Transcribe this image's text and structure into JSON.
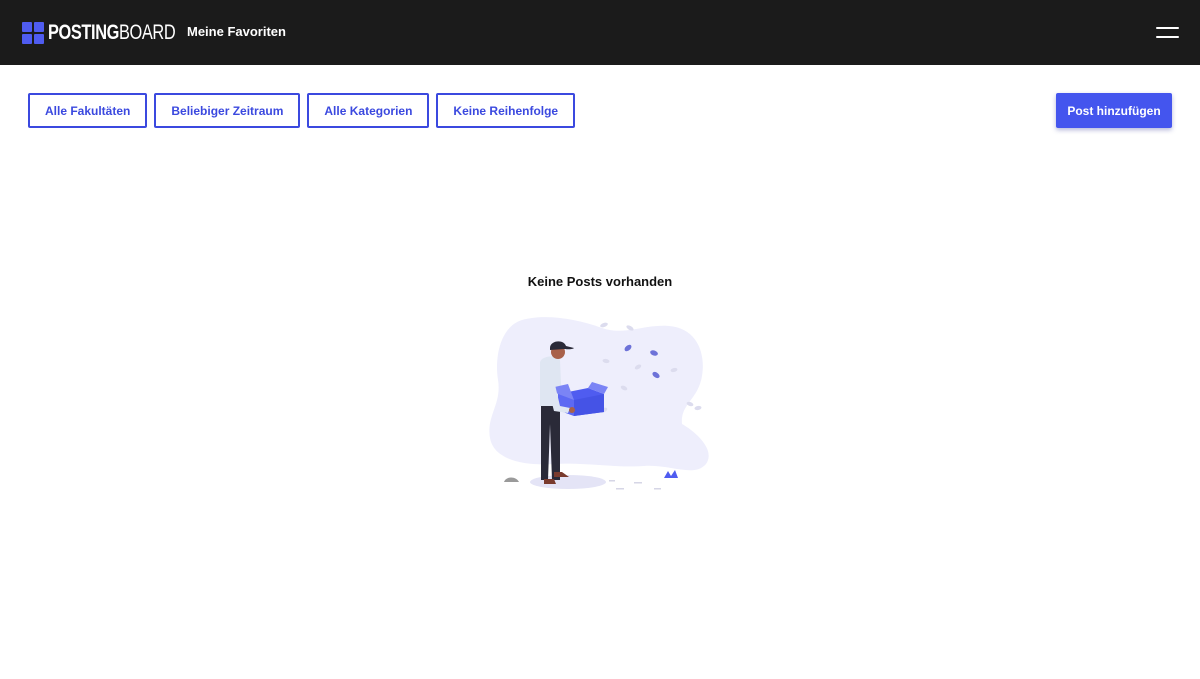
{
  "header": {
    "logo_bold": "POSTING",
    "logo_light": "BOARD",
    "nav_title": "Meine Favoriten",
    "menu_icon": "hamburger-menu-icon"
  },
  "filters": [
    {
      "label": "Alle Fakultäten"
    },
    {
      "label": "Beliebiger Zeitraum"
    },
    {
      "label": "Alle Kategorien"
    },
    {
      "label": "Keine Reihenfolge"
    }
  ],
  "actions": {
    "add_post_label": "Post hinzufügen"
  },
  "empty_state": {
    "title": "Keine Posts vorhanden",
    "illustration": "person-holding-empty-box-illustration"
  },
  "colors": {
    "header_bg": "#1b1b1b",
    "accent": "#3b49df",
    "accent_button": "#4455ee",
    "illustration_blob": "#eeeefc"
  }
}
